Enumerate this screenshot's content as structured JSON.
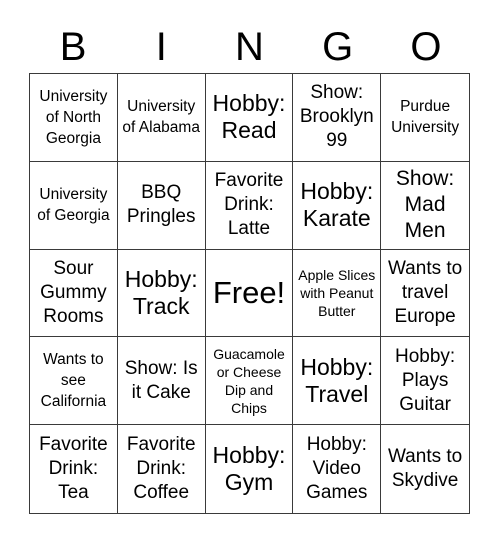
{
  "header": {
    "letters": [
      "B",
      "I",
      "N",
      "G",
      "O"
    ]
  },
  "cells": [
    {
      "text": "University of North Georgia",
      "size": "s-sm"
    },
    {
      "text": "University of Alabama",
      "size": "s-sm"
    },
    {
      "text": "Hobby: Read",
      "size": "s-xl"
    },
    {
      "text": "Show: Brooklyn 99",
      "size": "s-md"
    },
    {
      "text": "Purdue University",
      "size": "s-sm"
    },
    {
      "text": "University of Georgia",
      "size": "s-sm"
    },
    {
      "text": "BBQ Pringles",
      "size": "s-md"
    },
    {
      "text": "Favorite Drink: Latte",
      "size": "s-md"
    },
    {
      "text": "Hobby: Karate",
      "size": "s-xl"
    },
    {
      "text": "Show: Mad Men",
      "size": "s-lg"
    },
    {
      "text": "Sour Gummy Rooms",
      "size": "s-md"
    },
    {
      "text": "Hobby: Track",
      "size": "s-xl"
    },
    {
      "text": "Free!",
      "size": "s-free"
    },
    {
      "text": "Apple Slices with Peanut Butter",
      "size": "s-xs"
    },
    {
      "text": "Wants to travel Europe",
      "size": "s-md"
    },
    {
      "text": "Wants to see California",
      "size": "s-sm"
    },
    {
      "text": "Show: Is it Cake",
      "size": "s-md"
    },
    {
      "text": "Guacamole or Cheese Dip and Chips",
      "size": "s-xs"
    },
    {
      "text": "Hobby: Travel",
      "size": "s-xl"
    },
    {
      "text": "Hobby: Plays Guitar",
      "size": "s-md"
    },
    {
      "text": "Favorite Drink: Tea",
      "size": "s-md"
    },
    {
      "text": "Favorite Drink: Coffee",
      "size": "s-md"
    },
    {
      "text": "Hobby: Gym",
      "size": "s-xl"
    },
    {
      "text": "Hobby: Video Games",
      "size": "s-md"
    },
    {
      "text": "Wants to Skydive",
      "size": "s-md"
    }
  ]
}
